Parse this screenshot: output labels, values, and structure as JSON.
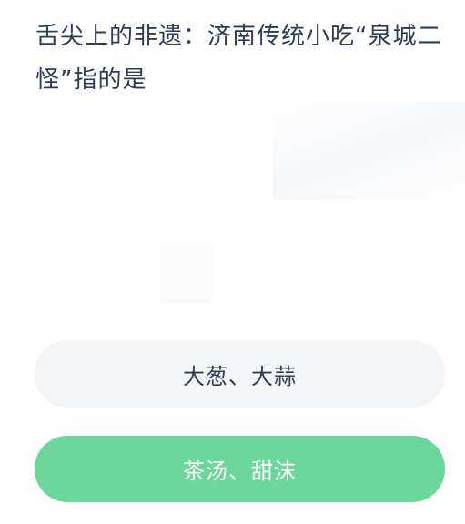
{
  "question": {
    "text": "舌尖上的非遗：济南传统小吃“泉城二怪”指的是"
  },
  "options": [
    {
      "label": "大葱、大蒜",
      "selected": false,
      "color": "#f4f5f7"
    },
    {
      "label": "茶汤、甜沫",
      "selected": true,
      "color": "#6cd79b"
    }
  ]
}
